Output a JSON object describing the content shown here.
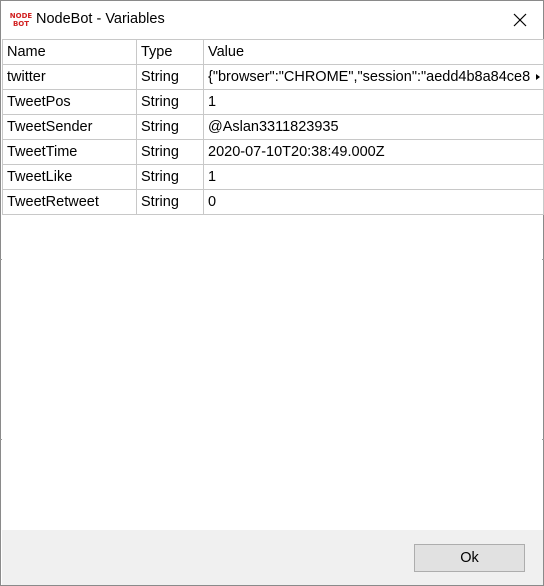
{
  "window": {
    "app_icon_lines": [
      "NODE",
      "BOT"
    ],
    "title": "NodeBot - Variables"
  },
  "table": {
    "columns": [
      "Name",
      "Type",
      "Value"
    ],
    "rows": [
      {
        "name": "twitter",
        "type": "String",
        "value": "{\"browser\":\"CHROME\",\"session\":\"aedd4b8a84ce8"
      },
      {
        "name": "TweetPos",
        "type": "String",
        "value": "1"
      },
      {
        "name": "TweetSender",
        "type": "String",
        "value": "@Aslan3311823935"
      },
      {
        "name": "TweetTime",
        "type": "String",
        "value": "2020-07-10T20:38:49.000Z"
      },
      {
        "name": "TweetLike",
        "type": "String",
        "value": "1"
      },
      {
        "name": "TweetRetweet",
        "type": "String",
        "value": "0"
      }
    ]
  },
  "footer": {
    "ok_label": "Ok"
  },
  "icons": {
    "app": "nodebot-logo-icon",
    "close": "close-icon",
    "overflow": "overflow-arrow-icon"
  },
  "colors": {
    "logo": "#d22222",
    "footer_bg": "#f0f0f0",
    "button_bg": "#e1e1e1",
    "grid_line": "#c8c8c8"
  }
}
